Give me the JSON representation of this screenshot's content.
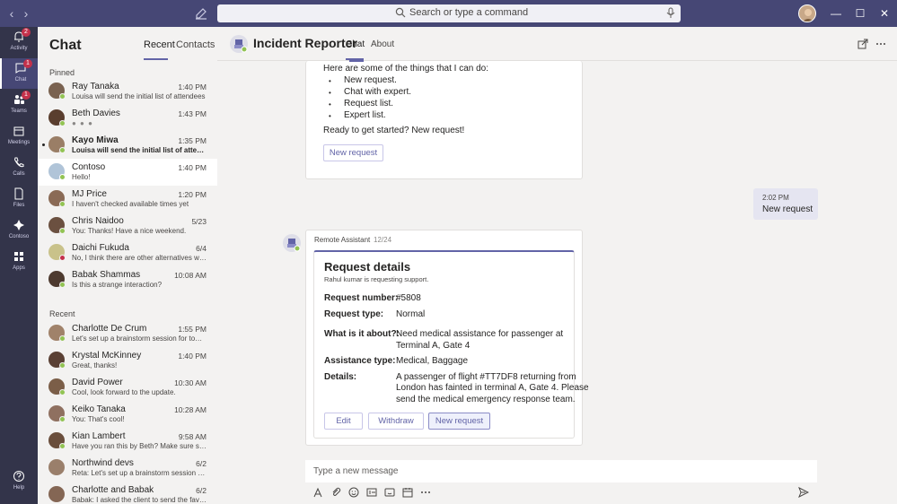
{
  "topbar": {
    "search_placeholder": "Search or type a command",
    "back_glyph": "‹",
    "forward_glyph": "›",
    "minimize_glyph": "—",
    "maximize_glyph": "☐",
    "close_glyph": "✕"
  },
  "rail": {
    "items": [
      {
        "label": "Activity",
        "badge": "2"
      },
      {
        "label": "Chat",
        "badge": "1"
      },
      {
        "label": "Teams",
        "badge": "1"
      },
      {
        "label": "Meetings",
        "badge": ""
      },
      {
        "label": "Calls",
        "badge": ""
      },
      {
        "label": "Files",
        "badge": ""
      },
      {
        "label": "Contoso",
        "badge": ""
      },
      {
        "label": "Apps",
        "badge": ""
      }
    ],
    "help_label": "Help"
  },
  "chatlist": {
    "title": "Chat",
    "tabs": [
      "Recent",
      "Contacts"
    ],
    "pinned_label": "Pinned",
    "recent_label": "Recent",
    "pinned": [
      {
        "name": "Ray Tanaka",
        "preview": "Louisa will send the initial list of attendees",
        "time": "1:40 PM"
      },
      {
        "name": "Beth Davies",
        "preview": "",
        "time": "1:43 PM"
      },
      {
        "name": "Kayo Miwa",
        "preview": "Louisa will send the initial list of attendees",
        "time": "1:35 PM"
      },
      {
        "name": "Contoso",
        "preview": "Hello!",
        "time": "1:40 PM"
      },
      {
        "name": "MJ Price",
        "preview": "I haven't checked available times yet",
        "time": "1:20 PM"
      },
      {
        "name": "Chris Naidoo",
        "preview": "You: Thanks! Have a nice weekend.",
        "time": "5/23"
      },
      {
        "name": "Daichi Fukuda",
        "preview": "No, I think there are other alternatives we c...",
        "time": "6/4"
      },
      {
        "name": "Babak Shammas",
        "preview": "Is this a strange interaction?",
        "time": "10:08 AM"
      }
    ],
    "recent": [
      {
        "name": "Charlotte De Crum",
        "preview": "Let's set up a brainstorm session for tomor...",
        "time": "1:55 PM"
      },
      {
        "name": "Krystal McKinney",
        "preview": "Great, thanks!",
        "time": "1:40 PM"
      },
      {
        "name": "David Power",
        "preview": "Cool, look forward to the update.",
        "time": "10:30 AM"
      },
      {
        "name": "Keiko Tanaka",
        "preview": "You: That's cool!",
        "time": "10:28 AM"
      },
      {
        "name": "Kian Lambert",
        "preview": "Have you ran this by Beth? Make sure she is...",
        "time": "9:58 AM"
      },
      {
        "name": "Northwind devs",
        "preview": "Reta: Let's set up a brainstorm session for...",
        "time": "6/2"
      },
      {
        "name": "Charlotte and Babak",
        "preview": "Babak: I asked the client to send the favo...",
        "time": "6/2"
      }
    ]
  },
  "header": {
    "title": "Incident Reporter",
    "tabs": [
      "Chat",
      "About"
    ]
  },
  "card1": {
    "intro": "Here are some of the things that I can do:",
    "items": [
      "New request.",
      "Chat with expert.",
      "Request list.",
      "Expert list."
    ],
    "cta": "Ready to get started? New request!",
    "button": "New request"
  },
  "sent": {
    "time": "2:02 PM",
    "text": "New request"
  },
  "card2": {
    "sender": "Remote Assistant",
    "date": "12/24",
    "title": "Request details",
    "subtitle": "Rahul kumar is requesting support.",
    "fields": [
      {
        "label": "Request number:",
        "value": "#5808"
      },
      {
        "label": "Request type:",
        "value": "Normal"
      },
      {
        "label": "What is it about?:",
        "value": "Need medical assistance for passenger at Terminal A, Gate 4"
      },
      {
        "label": "Assistance type:",
        "value": "Medical, Baggage"
      },
      {
        "label": "Details:",
        "value": "A passenger of flight #TT7DF8 returning from London has fainted in terminal A, Gate 4. Please send the medical emergency response team."
      }
    ],
    "value_lines": {
      "about_1": "Need medical assistance for passenger at",
      "about_2": "Terminal A, Gate 4",
      "details_1": "A passenger of flight #TT7DF8 returning from",
      "details_2": "London has fainted in terminal A, Gate 4. Please",
      "details_3": "send the medical emergency response team."
    },
    "buttons": [
      "Edit",
      "Withdraw",
      "New request"
    ]
  },
  "composer": {
    "placeholder": "Type a new message"
  },
  "colors": {
    "brand": "#6264a7",
    "topbar": "#464775",
    "rail": "#33344a",
    "presence": "#92c353",
    "badge": "#c4314b"
  }
}
